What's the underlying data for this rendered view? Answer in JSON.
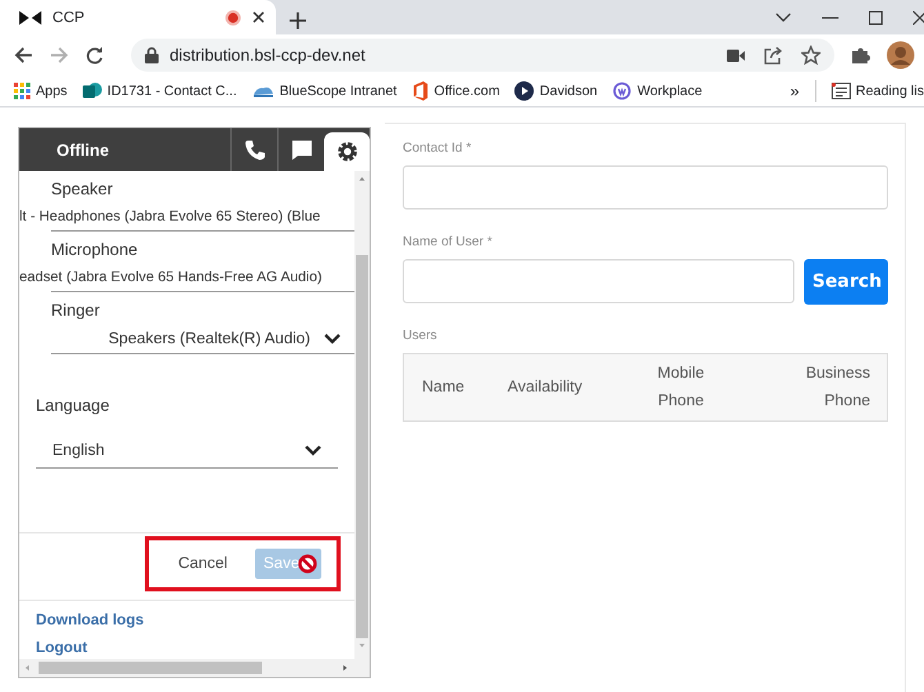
{
  "browser": {
    "tab": {
      "title": "CCP",
      "recording": true
    },
    "address": "distribution.bsl-ccp-dev.net",
    "bookmarks": [
      {
        "label": "Apps",
        "kind": "apps"
      },
      {
        "label": "ID1731 - Contact C...",
        "kind": "sharepoint"
      },
      {
        "label": "BlueScope Intranet",
        "kind": "intranet"
      },
      {
        "label": "Office.com",
        "kind": "office"
      },
      {
        "label": "Davidson",
        "kind": "play"
      },
      {
        "label": "Workplace",
        "kind": "workplace"
      }
    ],
    "more": "»",
    "reading_list": "Reading lis"
  },
  "ccp": {
    "status": "Offline",
    "nav": [
      {
        "kind": "phone",
        "selected": false
      },
      {
        "kind": "chat",
        "selected": false
      },
      {
        "kind": "settings",
        "selected": true
      }
    ],
    "devices": [
      {
        "label": "Speaker",
        "value": "lt - Headphones (Jabra Evolve 65 Stereo) (Blue",
        "kind": "text"
      },
      {
        "label": "Microphone",
        "value": "eadset (Jabra Evolve 65 Hands-Free AG Audio)",
        "kind": "text"
      },
      {
        "label": "Ringer",
        "value": "Speakers (Realtek(R) Audio)",
        "kind": "select"
      }
    ],
    "language": {
      "label": "Language",
      "value": "English"
    },
    "actions": [
      {
        "label": "Cancel",
        "kind": "text",
        "disabled": false
      },
      {
        "label": "Save",
        "kind": "primary",
        "disabled": true
      }
    ],
    "links": [
      "Download logs",
      "Logout"
    ]
  },
  "search": {
    "fields": [
      {
        "label": "Contact Id *"
      },
      {
        "label": "Name of User *"
      }
    ],
    "button": "Search",
    "table": {
      "caption": "Users",
      "columns": [
        "Name",
        "Availability",
        "Mobile Phone",
        "Business Phone"
      ]
    }
  }
}
